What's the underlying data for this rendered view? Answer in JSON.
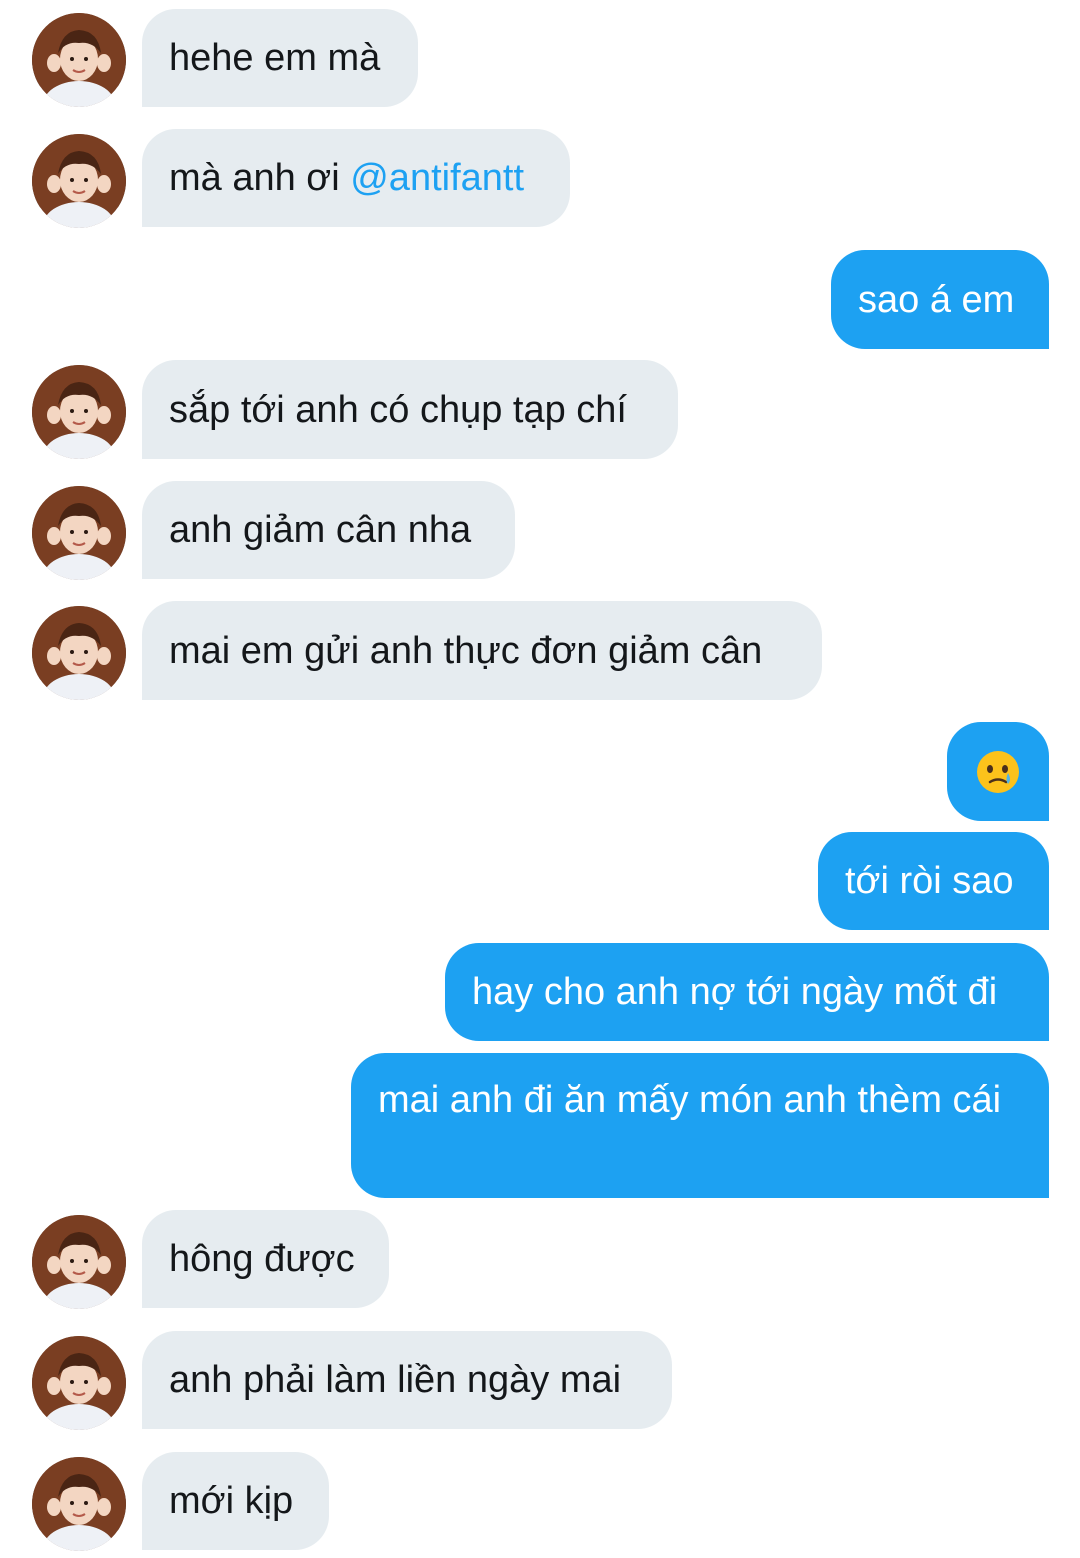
{
  "conversation": {
    "messages": [
      {
        "sender": "them",
        "text": "hehe em mà"
      },
      {
        "sender": "them",
        "text_prefix": "mà anh ơi ",
        "mention": "@antifantt"
      },
      {
        "sender": "me",
        "text": "sao á em"
      },
      {
        "sender": "them",
        "text": "sắp tới anh có chụp tạp chí"
      },
      {
        "sender": "them",
        "text": "anh giảm cân nha"
      },
      {
        "sender": "them",
        "text": "mai em gửi anh thực đơn giảm cân"
      },
      {
        "sender": "me",
        "emoji": "crying-face-emoji"
      },
      {
        "sender": "me",
        "text": "tới ròi sao"
      },
      {
        "sender": "me",
        "text": "hay cho anh nợ tới ngày mốt đi"
      },
      {
        "sender": "me",
        "text": "mai anh đi ăn mấy món anh thèm cái"
      },
      {
        "sender": "them",
        "text": "hông được"
      },
      {
        "sender": "them",
        "text": "anh phải làm liền ngày mai"
      },
      {
        "sender": "them",
        "text": "mới kịp"
      }
    ]
  },
  "colors": {
    "sent_bubble": "#1da1f2",
    "received_bubble": "#e6ecf0",
    "received_text": "#14171a",
    "mention": "#1da1f2"
  }
}
